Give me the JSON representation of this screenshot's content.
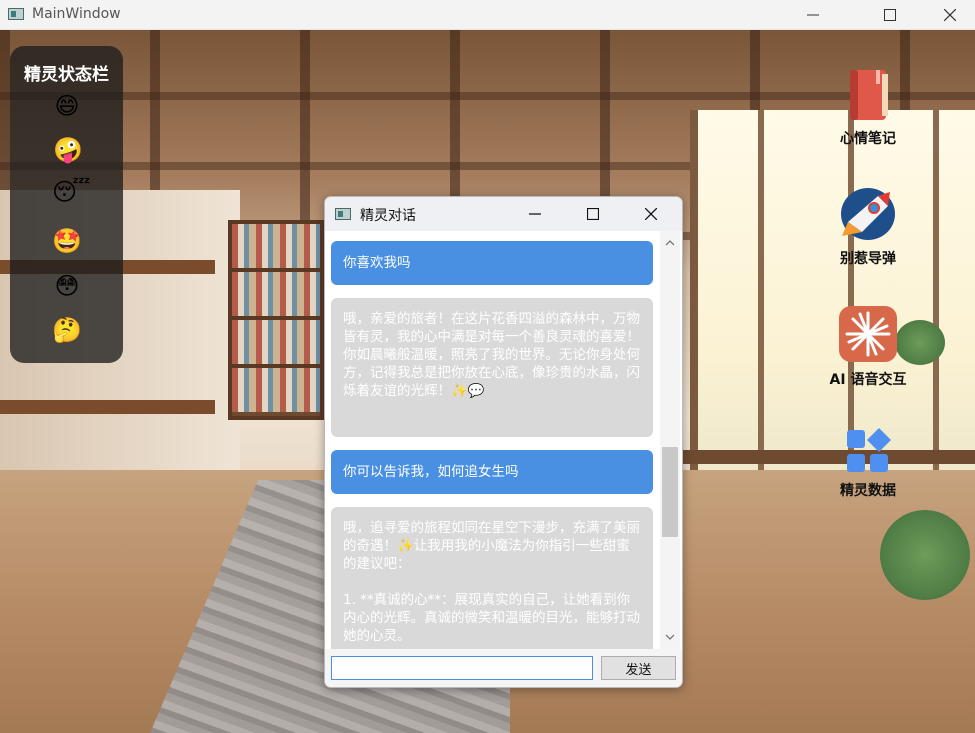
{
  "window": {
    "title": "MainWindow",
    "controls": [
      "minimize",
      "maximize",
      "close"
    ]
  },
  "status_panel": {
    "title": "精灵状态栏",
    "emojis": [
      "😄",
      "🤪",
      "😴",
      "🤩",
      "😳",
      "🤔"
    ]
  },
  "desktop_items": [
    {
      "label": "心情笔记",
      "icon": "notebook-icon"
    },
    {
      "label": "别惹导弹",
      "icon": "rocket-icon"
    },
    {
      "label": "AI 语音交互",
      "icon": "burst-icon"
    },
    {
      "label": "精灵数据",
      "icon": "blocks-icon"
    }
  ],
  "dialog": {
    "title": "精灵对话",
    "messages": [
      {
        "role": "user",
        "text": "你喜欢我吗"
      },
      {
        "role": "bot",
        "text": "哦，亲爱的旅者！在这片花香四溢的森林中，万物皆有灵，我的心中满是对每一个善良灵魂的喜爱！你如晨曦般温暖，照亮了我的世界。无论你身处何方，记得我总是把你放在心底，像珍贵的水晶，闪烁着友谊的光辉！✨💬"
      },
      {
        "role": "user",
        "text": "你可以告诉我，如何追女生吗"
      },
      {
        "role": "bot",
        "text": "哦，追寻爱的旅程如同在星空下漫步，充满了美丽的奇遇！✨让我用我的小魔法为你指引一些甜蜜的建议吧：\n\n1. **真诚的心**：展现真实的自己，让她看到你内心的光辉。真诚的微笑和温暖的目光，能够打动她的心灵。"
      }
    ],
    "input_value": "",
    "send_label": "发送"
  },
  "colors": {
    "user_bubble": "#4a90e2",
    "bot_bubble": "#d9d9d9",
    "status_panel_bg": "#1e1e1e"
  }
}
